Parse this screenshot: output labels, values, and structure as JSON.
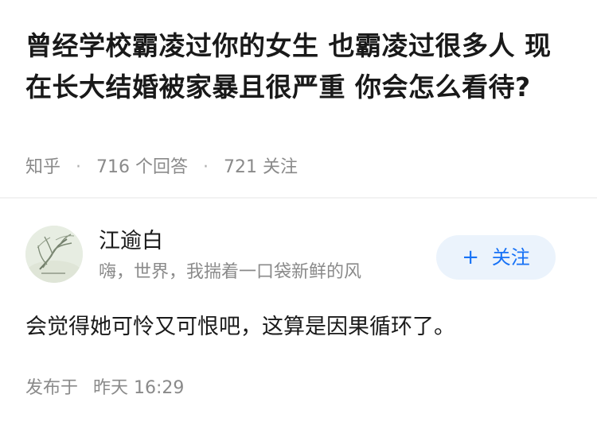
{
  "question": {
    "title": "曾经学校霸凌过你的女生 也霸凌过很多人 现在长大结婚被家暴且很严重 你会怎么看待?",
    "meta": {
      "source": "知乎",
      "answers_count": "716 个回答",
      "followers_count": "721 关注"
    }
  },
  "answer": {
    "author": {
      "name": "江逾白",
      "bio": "嗨，世界，我揣着一口袋新鲜的风",
      "avatar_icon": "tree-landscape-avatar-icon"
    },
    "follow_button": {
      "plus": "+",
      "label": "关注"
    },
    "content": "会觉得她可怜又可恨吧，这算是因果循环了。",
    "published": {
      "prefix": "发布于",
      "time": "昨天 16:29"
    }
  },
  "colors": {
    "title": "#191919",
    "meta": "#8a8a8a",
    "accent": "#1772f6",
    "follow_bg": "#ebf3fc",
    "divider": "#f2f2f2"
  }
}
